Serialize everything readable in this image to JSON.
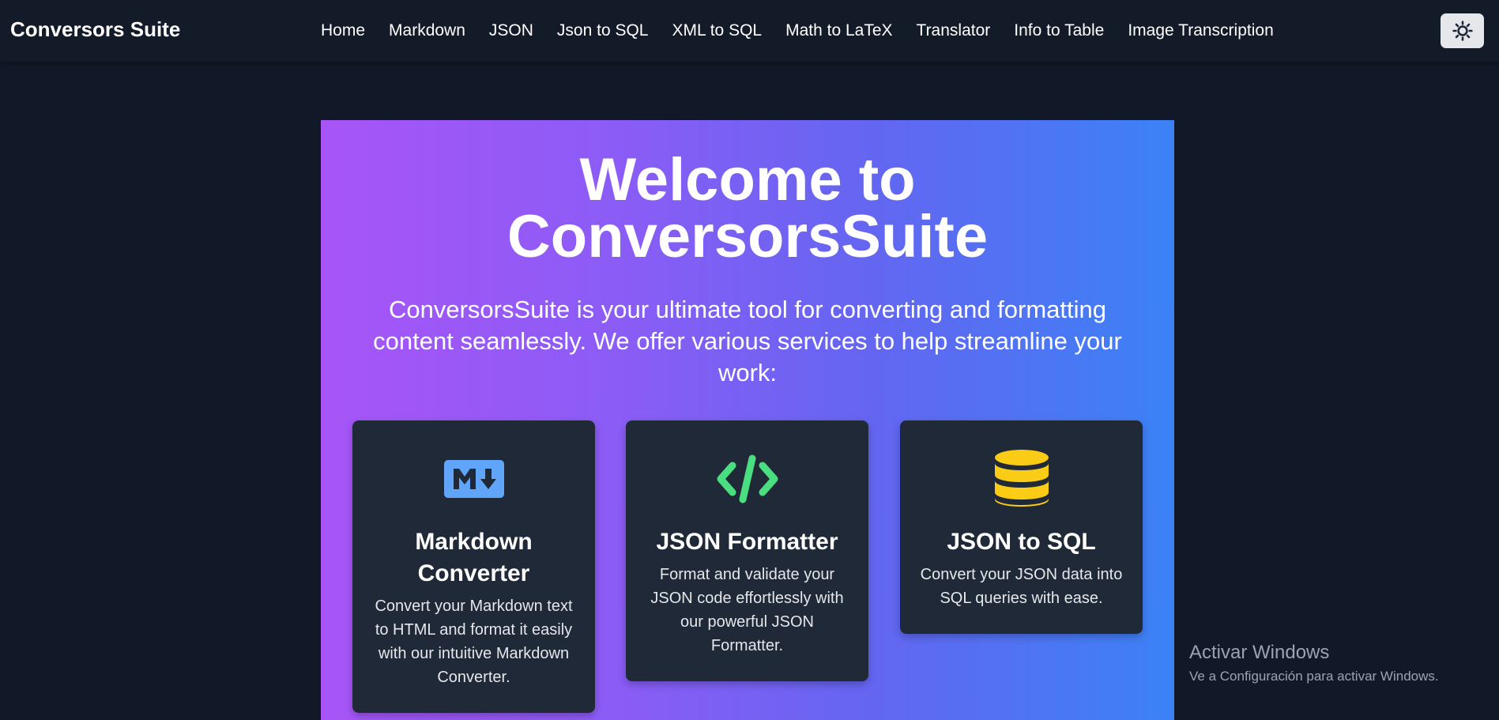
{
  "navbar": {
    "brand": "Conversors Suite",
    "links": [
      "Home",
      "Markdown",
      "JSON",
      "Json to SQL",
      "XML to SQL",
      "Math to LaTeX",
      "Translator",
      "Info to Table",
      "Image Transcription"
    ],
    "theme_toggle_icon": "sun-icon"
  },
  "hero": {
    "title_line1": "Welcome to",
    "title_line2": "ConversorsSuite",
    "subtitle": "ConversorsSuite is your ultimate tool for converting and formatting content seamlessly. We offer various services to help streamline your work:"
  },
  "cards": [
    {
      "icon": "markdown-icon",
      "title": "Markdown Converter",
      "description": "Convert your Markdown text to HTML and format it easily with our intuitive Markdown Converter."
    },
    {
      "icon": "code-icon",
      "title": "JSON Formatter",
      "description": "Format and validate your JSON code effortlessly with our powerful JSON Formatter."
    },
    {
      "icon": "database-icon",
      "title": "JSON to SQL",
      "description": "Convert your JSON data into SQL queries with ease."
    }
  ],
  "watermark": {
    "title": "Activar Windows",
    "subtitle": "Ve a Configuración para activar Windows."
  },
  "colors": {
    "background": "#111827",
    "card": "#1f2937",
    "gradient_start": "#a855f7",
    "gradient_end": "#3b82f6",
    "markdown_icon": "#60a5fa",
    "code_icon": "#4ade80",
    "database_icon": "#facc15"
  }
}
